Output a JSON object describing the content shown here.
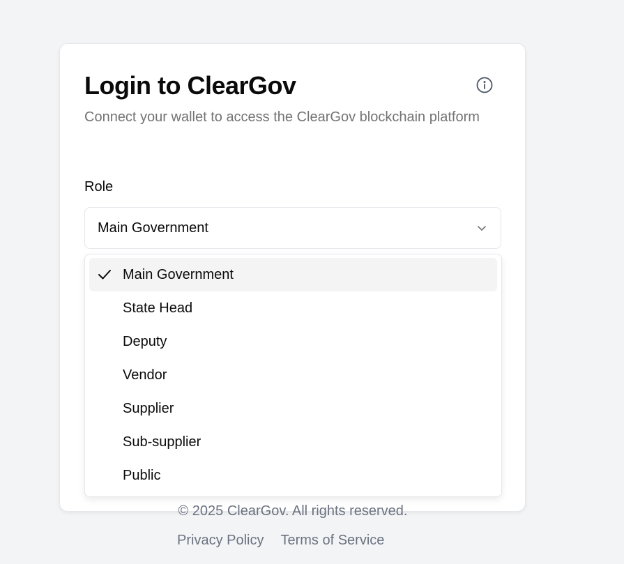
{
  "login": {
    "title": "Login to ClearGov",
    "subtitle": "Connect your wallet to access the ClearGov blockchain platform",
    "info_icon": "info-circle-icon"
  },
  "role": {
    "label": "Role",
    "selected": "Main Government",
    "options": [
      {
        "label": "Main Government",
        "selected": true
      },
      {
        "label": "State Head",
        "selected": false
      },
      {
        "label": "Deputy",
        "selected": false
      },
      {
        "label": "Vendor",
        "selected": false
      },
      {
        "label": "Supplier",
        "selected": false
      },
      {
        "label": "Sub-supplier",
        "selected": false
      },
      {
        "label": "Public",
        "selected": false
      }
    ]
  },
  "footer": {
    "copyright": "© 2025 ClearGov. All rights reserved.",
    "privacy": "Privacy Policy",
    "terms": "Terms of Service"
  },
  "colors": {
    "background": "#f3f4f6",
    "card": "#ffffff",
    "muted_text": "#737373",
    "selected_option_bg": "#f4f4f5"
  }
}
